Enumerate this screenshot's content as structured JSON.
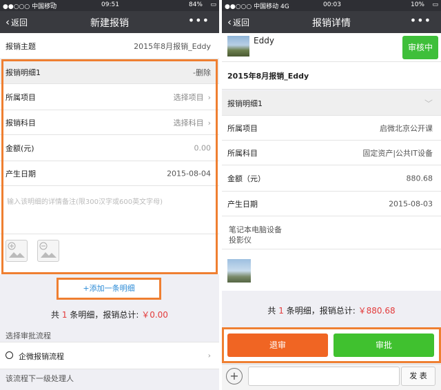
{
  "left": {
    "status": {
      "carrier": "●●○○○ 中国移动",
      "time": "09:51",
      "battery": "84%"
    },
    "nav": {
      "back": "返回",
      "title": "新建报销",
      "more": "•••"
    },
    "subject": {
      "label": "报销主题",
      "value": "2015年8月报销_Eddy"
    },
    "detail": {
      "header": "报销明细1",
      "delete": "-删除",
      "project": {
        "label": "所属项目",
        "value": "选择项目"
      },
      "account": {
        "label": "报销科目",
        "value": "选择科目"
      },
      "amount": {
        "label": "金额(元)",
        "value": "0.00"
      },
      "date": {
        "label": "产生日期",
        "value": "2015-08-04"
      },
      "note_placeholder": "输入该明细的详情备注(限300汉字或600英文字母)"
    },
    "add_detail": "+添加一条明细",
    "total": {
      "prefix": "共",
      "count": "1",
      "mid": "条明细，报销总计:",
      "amount": "￥0.00"
    },
    "approval_section": "选择审批流程",
    "flow": "企微报销流程",
    "next_handler": "该流程下一级处理人"
  },
  "right": {
    "status": {
      "carrier": "●●○○○ 中国移动  4G",
      "time": "00:03",
      "battery": "10%"
    },
    "nav": {
      "back": "返回",
      "title": "报销详情",
      "more": "•••"
    },
    "user": "Eddy",
    "status_badge": "审核中",
    "subject": "2015年8月报销_Eddy",
    "detail_header": "报销明细1",
    "project": {
      "label": "所属项目",
      "value": "启微北京公开课"
    },
    "account": {
      "label": "所属科目",
      "value": "固定资产|公共IT设备"
    },
    "amount": {
      "label": "金额（元）",
      "value": "880.68"
    },
    "date": {
      "label": "产生日期",
      "value": "2015-08-03"
    },
    "notes": [
      "笔记本电脑设备",
      "投影仪"
    ],
    "total": {
      "prefix": "共",
      "count": "1",
      "mid": "条明细，报销总计:",
      "amount": "￥880.68"
    },
    "reject": "退审",
    "approve": "审批",
    "send": "发 表",
    "plus": "+"
  },
  "colors": {
    "highlight": "#ef7f31",
    "reject": "#f06523",
    "approve": "#40c12f",
    "badge": "#3fbf3a",
    "navbar": "#393a3f"
  }
}
